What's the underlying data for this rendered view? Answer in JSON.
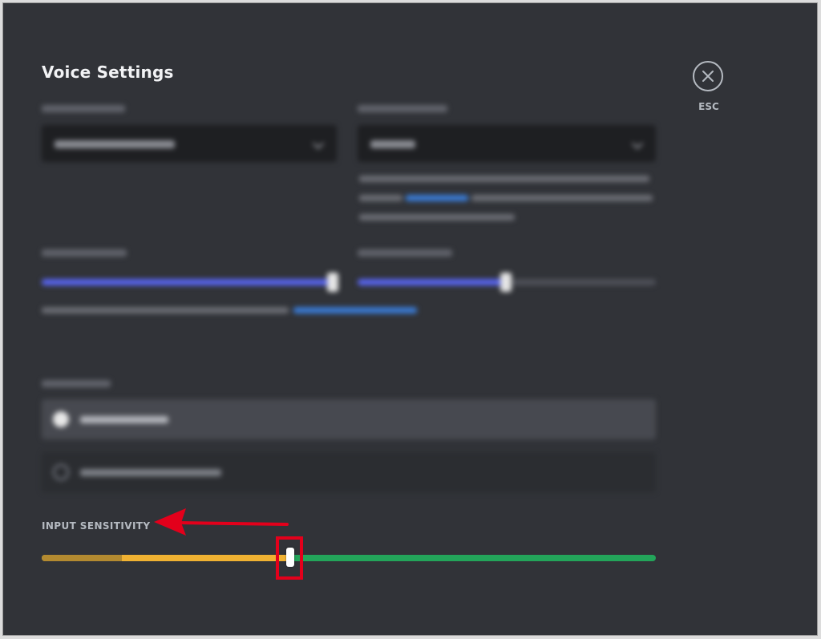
{
  "dialog": {
    "title": "Voice Settings",
    "close_label": "ESC"
  },
  "input_sensitivity": {
    "label": "INPUT SENSITIVITY",
    "threshold_fraction": 0.405,
    "level_fraction": 0.13
  },
  "colors": {
    "background": "#313338",
    "slider_blue": "#5865f2",
    "sensitivity_yellow": "#f0b232",
    "sensitivity_green": "#23a55a",
    "annotation_red": "#e3001b"
  },
  "icons": {
    "close": "close-icon",
    "annotation": "red-arrow-annotation"
  }
}
